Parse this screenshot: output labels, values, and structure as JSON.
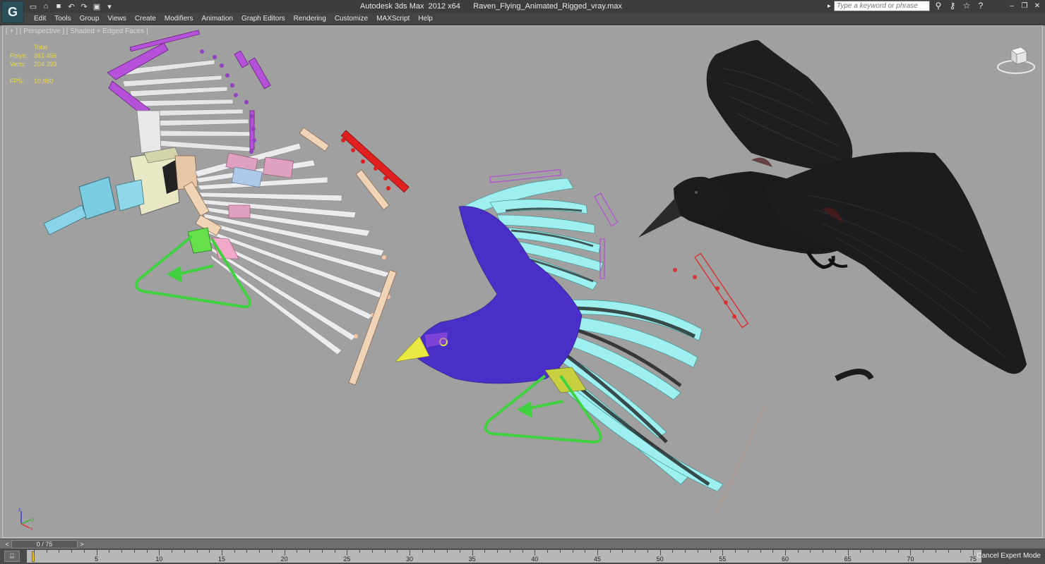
{
  "app": {
    "logo_icon": "3dsmax-logo-icon",
    "title": "Autodesk 3ds Max  2012 x64      Raven_Flying_Animated_Rigged_vray.max"
  },
  "quick_access": [
    "new-file-icon",
    "open-file-icon",
    "save-icon",
    "undo-icon",
    "redo-icon",
    "project-folder-icon"
  ],
  "search": {
    "placeholder": "Type a keyword or phrase"
  },
  "info_tools": [
    "binoculars-icon",
    "key-icon",
    "star-icon",
    "help-icon"
  ],
  "menu": [
    "Edit",
    "Tools",
    "Group",
    "Views",
    "Create",
    "Modifiers",
    "Animation",
    "Graph Editors",
    "Rendering",
    "Customize",
    "MAXScript",
    "Help"
  ],
  "viewport": {
    "label": "[ + ] [ Perspective ] [ Shaded + Edged Faces ]",
    "stats": {
      "header": "Total",
      "rows": [
        {
          "label": "Polys:",
          "value": "361 456"
        },
        {
          "label": "Verts:",
          "value": "204 393"
        },
        {
          "label": "FPS:",
          "value": "10,880"
        }
      ]
    },
    "axes": {
      "z": "z",
      "y": "y",
      "x": "x"
    },
    "colors": {
      "background": "#a0a0a0",
      "bone_white": "#e8e8ea",
      "rig_purple": "#b050d0",
      "rig_red": "#e02020",
      "rig_green": "#40d040",
      "wire_cyan": "#88f0f0",
      "mesh_blue": "#4a2ec8",
      "raven_black": "#1c1c1e"
    }
  },
  "timeslider": {
    "frame": "0 / 75",
    "prev": "<",
    "next": ">"
  },
  "trackbar": {
    "ticks": [
      "0",
      "5",
      "10",
      "15",
      "20",
      "25",
      "30",
      "35",
      "40",
      "45",
      "50",
      "55",
      "60",
      "65",
      "70",
      "75"
    ],
    "cancel_label": "Cancel Expert Mode"
  }
}
